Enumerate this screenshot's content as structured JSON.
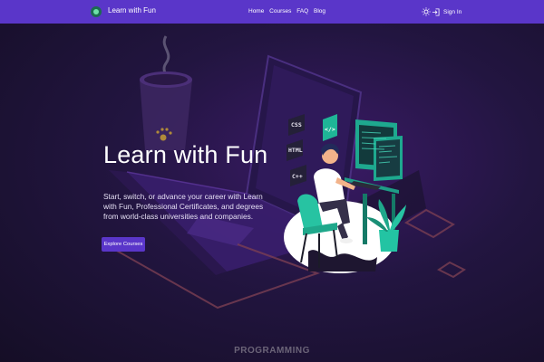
{
  "nav": {
    "brand": "Learn with Fun",
    "links": [
      "Home",
      "Courses",
      "FAQ",
      "Blog"
    ],
    "sign_in": "Sign In"
  },
  "hero": {
    "title": "Learn with Fun",
    "description": "Start, switch, or advance your career with Learn with Fun, Professional Certificates, and degrees from world-class universities and companies.",
    "cta": "Explore Courses"
  },
  "illustration": {
    "tags": [
      "CSS",
      "HTML",
      "C++"
    ],
    "code_icon": "</>"
  },
  "section": {
    "label": "PROGRAMMING"
  },
  "colors": {
    "accent": "#5a36c9",
    "background": "#1a1130",
    "text": "#ffffff"
  },
  "icons": [
    "logo-icon",
    "sun-icon",
    "sign-in-icon"
  ]
}
